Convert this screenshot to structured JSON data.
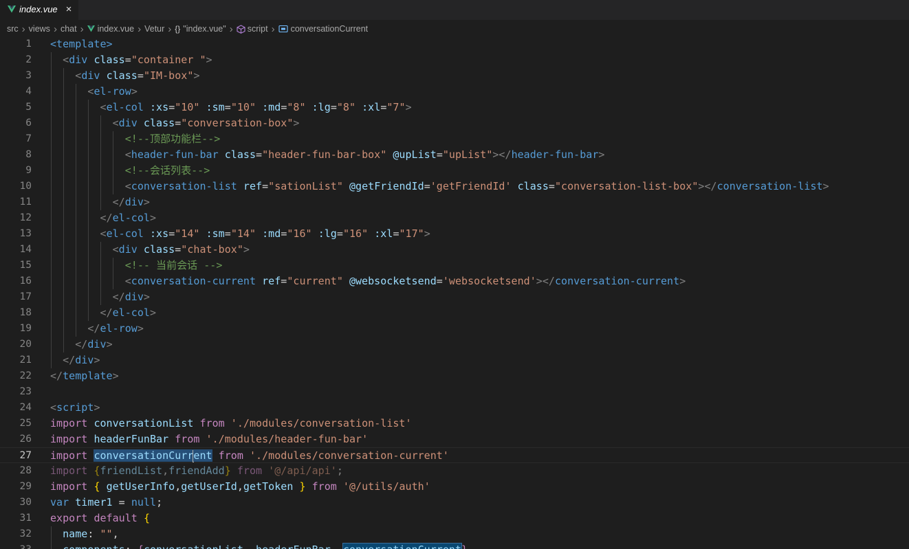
{
  "tab": {
    "title": "index.vue",
    "close_icon": "×",
    "accent": "#41b883"
  },
  "breadcrumb": [
    {
      "label": "src",
      "icon": ""
    },
    {
      "label": "views",
      "icon": ""
    },
    {
      "label": "chat",
      "icon": ""
    },
    {
      "label": "index.vue",
      "icon": "vue-icon"
    },
    {
      "label": "Vetur",
      "icon": ""
    },
    {
      "label": "\"index.vue\"",
      "icon": "braces-icon"
    },
    {
      "label": "script",
      "icon": "cube-icon"
    },
    {
      "label": "conversationCurrent",
      "icon": "variable-icon"
    }
  ],
  "editor": {
    "current_line": 27,
    "lines": [
      {
        "n": "1",
        "tokens": [
          [
            "tag",
            "<template>"
          ]
        ]
      },
      {
        "n": "2",
        "tokens": [
          [
            "txt",
            "  "
          ],
          [
            "punc",
            "<"
          ],
          [
            "tag",
            "div"
          ],
          [
            "txt",
            " "
          ],
          [
            "attr",
            "class"
          ],
          [
            "txt",
            "="
          ],
          [
            "str",
            "\"container \""
          ],
          [
            "punc",
            ">"
          ]
        ]
      },
      {
        "n": "3",
        "tokens": [
          [
            "txt",
            "    "
          ],
          [
            "punc",
            "<"
          ],
          [
            "tag",
            "div"
          ],
          [
            "txt",
            " "
          ],
          [
            "attr",
            "class"
          ],
          [
            "txt",
            "="
          ],
          [
            "str",
            "\"IM-box\""
          ],
          [
            "punc",
            ">"
          ]
        ]
      },
      {
        "n": "4",
        "tokens": [
          [
            "txt",
            "      "
          ],
          [
            "punc",
            "<"
          ],
          [
            "tag",
            "el-row"
          ],
          [
            "punc",
            ">"
          ]
        ]
      },
      {
        "n": "5",
        "tokens": [
          [
            "txt",
            "        "
          ],
          [
            "punc",
            "<"
          ],
          [
            "tag",
            "el-col"
          ],
          [
            "txt",
            " "
          ],
          [
            "attr",
            ":xs"
          ],
          [
            "txt",
            "="
          ],
          [
            "str",
            "\"10\""
          ],
          [
            "txt",
            " "
          ],
          [
            "attr",
            ":sm"
          ],
          [
            "txt",
            "="
          ],
          [
            "str",
            "\"10\""
          ],
          [
            "txt",
            " "
          ],
          [
            "attr",
            ":md"
          ],
          [
            "txt",
            "="
          ],
          [
            "str",
            "\"8\""
          ],
          [
            "txt",
            " "
          ],
          [
            "attr",
            ":lg"
          ],
          [
            "txt",
            "="
          ],
          [
            "str",
            "\"8\""
          ],
          [
            "txt",
            " "
          ],
          [
            "attr",
            ":xl"
          ],
          [
            "txt",
            "="
          ],
          [
            "str",
            "\"7\""
          ],
          [
            "punc",
            ">"
          ]
        ]
      },
      {
        "n": "6",
        "tokens": [
          [
            "txt",
            "          "
          ],
          [
            "punc",
            "<"
          ],
          [
            "tag",
            "div"
          ],
          [
            "txt",
            " "
          ],
          [
            "attr",
            "class"
          ],
          [
            "txt",
            "="
          ],
          [
            "str",
            "\"conversation-box\""
          ],
          [
            "punc",
            ">"
          ]
        ]
      },
      {
        "n": "7",
        "tokens": [
          [
            "txt",
            "            "
          ],
          [
            "cmt",
            "<!--顶部功能栏-->"
          ]
        ]
      },
      {
        "n": "8",
        "tokens": [
          [
            "txt",
            "            "
          ],
          [
            "punc",
            "<"
          ],
          [
            "tag",
            "header-fun-bar"
          ],
          [
            "txt",
            " "
          ],
          [
            "attr",
            "class"
          ],
          [
            "txt",
            "="
          ],
          [
            "str",
            "\"header-fun-bar-box\""
          ],
          [
            "txt",
            " "
          ],
          [
            "attr",
            "@upList"
          ],
          [
            "txt",
            "="
          ],
          [
            "str",
            "\"upList\""
          ],
          [
            "punc",
            "></"
          ],
          [
            "tag",
            "header-fun-bar"
          ],
          [
            "punc",
            ">"
          ]
        ]
      },
      {
        "n": "9",
        "tokens": [
          [
            "txt",
            "            "
          ],
          [
            "cmt",
            "<!--会话列表-->"
          ]
        ]
      },
      {
        "n": "10",
        "tokens": [
          [
            "txt",
            "            "
          ],
          [
            "punc",
            "<"
          ],
          [
            "tag",
            "conversation-list"
          ],
          [
            "txt",
            " "
          ],
          [
            "attr",
            "ref"
          ],
          [
            "txt",
            "="
          ],
          [
            "str",
            "\"sationList\""
          ],
          [
            "txt",
            " "
          ],
          [
            "attr",
            "@getFriendId"
          ],
          [
            "txt",
            "="
          ],
          [
            "str",
            "'getFriendId'"
          ],
          [
            "txt",
            " "
          ],
          [
            "attr",
            "class"
          ],
          [
            "txt",
            "="
          ],
          [
            "str",
            "\"conversation-list-box\""
          ],
          [
            "punc",
            "></"
          ],
          [
            "tag",
            "conversation-list"
          ],
          [
            "punc",
            ">"
          ]
        ]
      },
      {
        "n": "11",
        "tokens": [
          [
            "txt",
            "          "
          ],
          [
            "punc",
            "</"
          ],
          [
            "tag",
            "div"
          ],
          [
            "punc",
            ">"
          ]
        ]
      },
      {
        "n": "12",
        "tokens": [
          [
            "txt",
            "        "
          ],
          [
            "punc",
            "</"
          ],
          [
            "tag",
            "el-col"
          ],
          [
            "punc",
            ">"
          ]
        ]
      },
      {
        "n": "13",
        "tokens": [
          [
            "txt",
            "        "
          ],
          [
            "punc",
            "<"
          ],
          [
            "tag",
            "el-col"
          ],
          [
            "txt",
            " "
          ],
          [
            "attr",
            ":xs"
          ],
          [
            "txt",
            "="
          ],
          [
            "str",
            "\"14\""
          ],
          [
            "txt",
            " "
          ],
          [
            "attr",
            ":sm"
          ],
          [
            "txt",
            "="
          ],
          [
            "str",
            "\"14\""
          ],
          [
            "txt",
            " "
          ],
          [
            "attr",
            ":md"
          ],
          [
            "txt",
            "="
          ],
          [
            "str",
            "\"16\""
          ],
          [
            "txt",
            " "
          ],
          [
            "attr",
            ":lg"
          ],
          [
            "txt",
            "="
          ],
          [
            "str",
            "\"16\""
          ],
          [
            "txt",
            " "
          ],
          [
            "attr",
            ":xl"
          ],
          [
            "txt",
            "="
          ],
          [
            "str",
            "\"17\""
          ],
          [
            "punc",
            ">"
          ]
        ]
      },
      {
        "n": "14",
        "tokens": [
          [
            "txt",
            "          "
          ],
          [
            "punc",
            "<"
          ],
          [
            "tag",
            "div"
          ],
          [
            "txt",
            " "
          ],
          [
            "attr",
            "class"
          ],
          [
            "txt",
            "="
          ],
          [
            "str",
            "\"chat-box\""
          ],
          [
            "punc",
            ">"
          ]
        ]
      },
      {
        "n": "15",
        "tokens": [
          [
            "txt",
            "            "
          ],
          [
            "cmt",
            "<!-- 当前会话 -->"
          ]
        ]
      },
      {
        "n": "16",
        "tokens": [
          [
            "txt",
            "            "
          ],
          [
            "punc",
            "<"
          ],
          [
            "tag",
            "conversation-current"
          ],
          [
            "txt",
            " "
          ],
          [
            "attr",
            "ref"
          ],
          [
            "txt",
            "="
          ],
          [
            "str",
            "\"current\""
          ],
          [
            "txt",
            " "
          ],
          [
            "attr",
            "@websocketsend"
          ],
          [
            "txt",
            "="
          ],
          [
            "str",
            "'websocketsend'"
          ],
          [
            "punc",
            "></"
          ],
          [
            "tag",
            "conversation-current"
          ],
          [
            "punc",
            ">"
          ]
        ]
      },
      {
        "n": "17",
        "tokens": [
          [
            "txt",
            "          "
          ],
          [
            "punc",
            "</"
          ],
          [
            "tag",
            "div"
          ],
          [
            "punc",
            ">"
          ]
        ]
      },
      {
        "n": "18",
        "tokens": [
          [
            "txt",
            "        "
          ],
          [
            "punc",
            "</"
          ],
          [
            "tag",
            "el-col"
          ],
          [
            "punc",
            ">"
          ]
        ]
      },
      {
        "n": "19",
        "tokens": [
          [
            "txt",
            "      "
          ],
          [
            "punc",
            "</"
          ],
          [
            "tag",
            "el-row"
          ],
          [
            "punc",
            ">"
          ]
        ]
      },
      {
        "n": "20",
        "tokens": [
          [
            "txt",
            "    "
          ],
          [
            "punc",
            "</"
          ],
          [
            "tag",
            "div"
          ],
          [
            "punc",
            ">"
          ]
        ]
      },
      {
        "n": "21",
        "tokens": [
          [
            "txt",
            "  "
          ],
          [
            "punc",
            "</"
          ],
          [
            "tag",
            "div"
          ],
          [
            "punc",
            ">"
          ]
        ]
      },
      {
        "n": "22",
        "tokens": [
          [
            "punc",
            "</"
          ],
          [
            "tag",
            "template"
          ],
          [
            "punc",
            ">"
          ]
        ]
      },
      {
        "n": "23",
        "tokens": []
      },
      {
        "n": "24",
        "tokens": [
          [
            "punc",
            "<"
          ],
          [
            "tag",
            "script"
          ],
          [
            "punc",
            ">"
          ]
        ]
      },
      {
        "n": "25",
        "tokens": [
          [
            "kw",
            "import"
          ],
          [
            "txt",
            " "
          ],
          [
            "var",
            "conversationList"
          ],
          [
            "txt",
            " "
          ],
          [
            "kw",
            "from"
          ],
          [
            "txt",
            " "
          ],
          [
            "str",
            "'./modules/conversation-list'"
          ]
        ]
      },
      {
        "n": "26",
        "tokens": [
          [
            "kw",
            "import"
          ],
          [
            "txt",
            " "
          ],
          [
            "var",
            "headerFunBar"
          ],
          [
            "txt",
            " "
          ],
          [
            "kw",
            "from"
          ],
          [
            "txt",
            " "
          ],
          [
            "str",
            "'./modules/header-fun-bar'"
          ]
        ]
      },
      {
        "n": "27",
        "tokens": [
          [
            "kw",
            "import"
          ],
          [
            "txt",
            " "
          ],
          [
            "var-hl",
            "conversationCurr"
          ],
          [
            "cursor",
            ""
          ],
          [
            "var-hl",
            "ent"
          ],
          [
            "txt",
            " "
          ],
          [
            "kw",
            "from"
          ],
          [
            "txt",
            " "
          ],
          [
            "str",
            "'./modules/conversation-current'"
          ]
        ]
      },
      {
        "n": "28",
        "tokens": [
          [
            "kw-dim",
            "import"
          ],
          [
            "txt",
            " "
          ],
          [
            "brace-dim",
            "{"
          ],
          [
            "var-dim",
            "friendList"
          ],
          [
            "txt-dim",
            ","
          ],
          [
            "var-dim",
            "friendAdd"
          ],
          [
            "brace-dim",
            "}"
          ],
          [
            "txt",
            " "
          ],
          [
            "kw-dim",
            "from"
          ],
          [
            "txt",
            " "
          ],
          [
            "str-dim",
            "'@/api/api'"
          ],
          [
            "txt-dim",
            ";"
          ]
        ]
      },
      {
        "n": "29",
        "tokens": [
          [
            "kw",
            "import"
          ],
          [
            "txt",
            " "
          ],
          [
            "brace",
            "{"
          ],
          [
            "txt",
            " "
          ],
          [
            "var",
            "getUserInfo"
          ],
          [
            "txt",
            ","
          ],
          [
            "var",
            "getUserId"
          ],
          [
            "txt",
            ","
          ],
          [
            "var",
            "getToken"
          ],
          [
            "txt",
            " "
          ],
          [
            "brace",
            "}"
          ],
          [
            "txt",
            " "
          ],
          [
            "kw",
            "from"
          ],
          [
            "txt",
            " "
          ],
          [
            "str",
            "'@/utils/auth'"
          ]
        ]
      },
      {
        "n": "30",
        "tokens": [
          [
            "decl",
            "var"
          ],
          [
            "txt",
            " "
          ],
          [
            "var",
            "timer1"
          ],
          [
            "txt",
            " = "
          ],
          [
            "decl",
            "null"
          ],
          [
            "txt",
            ";"
          ]
        ]
      },
      {
        "n": "31",
        "tokens": [
          [
            "kw",
            "export"
          ],
          [
            "txt",
            " "
          ],
          [
            "kw",
            "default"
          ],
          [
            "txt",
            " "
          ],
          [
            "brace",
            "{"
          ]
        ]
      },
      {
        "n": "32",
        "tokens": [
          [
            "txt",
            "  "
          ],
          [
            "var",
            "name"
          ],
          [
            "txt",
            ": "
          ],
          [
            "str",
            "\"\""
          ],
          [
            "txt",
            ","
          ]
        ]
      },
      {
        "n": "33",
        "tokens": [
          [
            "txt",
            "  "
          ],
          [
            "var",
            "components"
          ],
          [
            "txt",
            ": "
          ],
          [
            "kw",
            "{"
          ],
          [
            "var",
            "conversationList"
          ],
          [
            "txt",
            ", "
          ],
          [
            "var",
            "headerFunBar"
          ],
          [
            "txt",
            ", "
          ],
          [
            "var-hl2",
            "conversationCurrent"
          ],
          [
            "kw",
            "}"
          ]
        ]
      }
    ]
  }
}
